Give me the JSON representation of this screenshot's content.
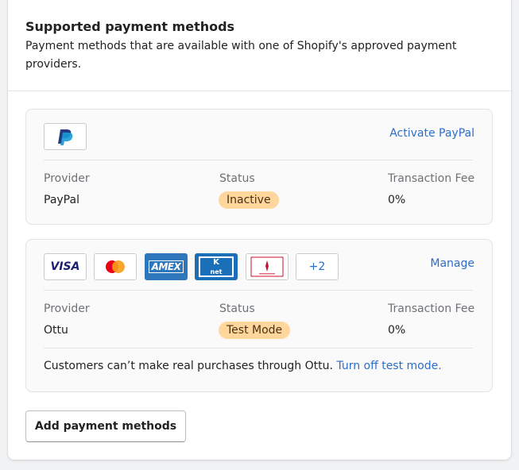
{
  "header": {
    "title": "Supported payment methods",
    "subtitle": "Payment methods that are available with one of Shopify's approved payment providers."
  },
  "columns": {
    "provider": "Provider",
    "status": "Status",
    "fee": "Transaction Fee"
  },
  "providers": [
    {
      "logos": [
        "paypal-icon"
      ],
      "action_label": "Activate PayPal",
      "name": "PayPal",
      "status": "Inactive",
      "fee": "0%"
    },
    {
      "logos": [
        "visa-icon",
        "mastercard-icon",
        "amex-icon",
        "knet-icon",
        "benefit-icon"
      ],
      "logo_texts": {
        "visa": "VISA",
        "amex": "AMEX",
        "knet": "net"
      },
      "more_count": "+2",
      "action_label": "Manage",
      "name": "Ottu",
      "status": "Test Mode",
      "fee": "0%",
      "notice": "Customers can’t make real purchases through Ottu.",
      "notice_link": "Turn off test mode."
    }
  ],
  "add_button_label": "Add payment methods",
  "colors": {
    "link": "#2c6ecb",
    "badge_warning": "#ffd79d",
    "paypal_dark": "#253b80",
    "paypal_light": "#179bd7",
    "visa": "#1a1f71",
    "mastercard_red": "#eb001b",
    "mastercard_orange": "#f79e1b",
    "amex": "#2e77bc",
    "knet": "#1b6fb8"
  }
}
